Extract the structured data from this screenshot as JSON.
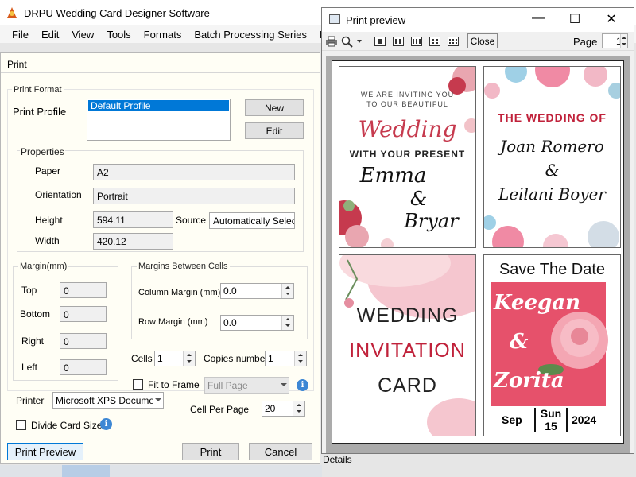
{
  "app": {
    "title": "DRPU Wedding Card Designer Software",
    "menu": [
      "File",
      "Edit",
      "View",
      "Tools",
      "Formats",
      "Batch Processing Series",
      "Mail"
    ],
    "details_label": "Details"
  },
  "print_dialog": {
    "title": "Print",
    "print_format_group": "Print Format",
    "print_profile_label": "Print Profile",
    "profiles": [
      "Default Profile"
    ],
    "new_button": "New",
    "edit_button": "Edit",
    "properties_group": "Properties",
    "paper_label": "Paper",
    "paper_value": "A2",
    "orientation_label": "Orientation",
    "orientation_value": "Portrait",
    "height_label": "Height",
    "height_value": "594.11",
    "source_label": "Source",
    "source_value": "Automatically Select",
    "width_label": "Width",
    "width_value": "420.12",
    "margin_group": "Margin(mm)",
    "top_label": "Top",
    "top_value": "0",
    "bottom_label": "Bottom",
    "bottom_value": "0",
    "right_label": "Right",
    "right_value": "0",
    "left_label": "Left",
    "left_value": "0",
    "cells_margin_group": "Margins Between Cells",
    "column_margin_label": "Column Margin (mm)",
    "column_margin_value": "0.0",
    "row_margin_label": "Row Margin (mm)",
    "row_margin_value": "0.0",
    "cells_label": "Cells",
    "cells_value": "1",
    "copies_label": "Copies number",
    "copies_value": "1",
    "fit_to_frame_label": "Fit to Frame",
    "fit_to_frame_checked": false,
    "fit_mode_value": "Full Page",
    "printer_label": "Printer",
    "printer_value": "Microsoft XPS Document",
    "cell_per_page_label": "Cell Per Page",
    "cell_per_page_value": "20",
    "divide_card_label": "Divide Card Size",
    "divide_card_checked": false,
    "print_preview_button": "Print Preview",
    "print_button": "Print",
    "cancel_button": "Cancel",
    "info_glyph": "i"
  },
  "preview_window": {
    "title": "Print preview",
    "close_button": "Close",
    "page_label": "Page",
    "page_value": "1",
    "min_glyph": "—",
    "max_glyph": "☐",
    "close_glyph": "✕",
    "cards": {
      "c1": {
        "line1": "WE ARE INVITING YOU",
        "line2": "TO OUR BEAUTIFUL",
        "line3": "Wedding",
        "line4": "WITH YOUR PRESENT",
        "line5": "Emma",
        "line6": "&",
        "line7": "Bryar"
      },
      "c2": {
        "line1": "THE WEDDING OF",
        "line2": "Joan Romero",
        "line3": "&",
        "line4": "Leilani Boyer"
      },
      "c3": {
        "line1": "WEDDING",
        "line2": "INVITATION",
        "line3": "CARD"
      },
      "c4": {
        "line1": "Save The Date",
        "line2": "Keegan",
        "line3": "&",
        "line4": "Zorita",
        "day": "Sep",
        "dow": "Sun",
        "date": "15",
        "year": "2024"
      }
    }
  },
  "colors": {
    "accent": "#0078d7",
    "rose": "#d64f63",
    "wedding_red": "#c0213a",
    "save_bg": "#e6516b"
  }
}
